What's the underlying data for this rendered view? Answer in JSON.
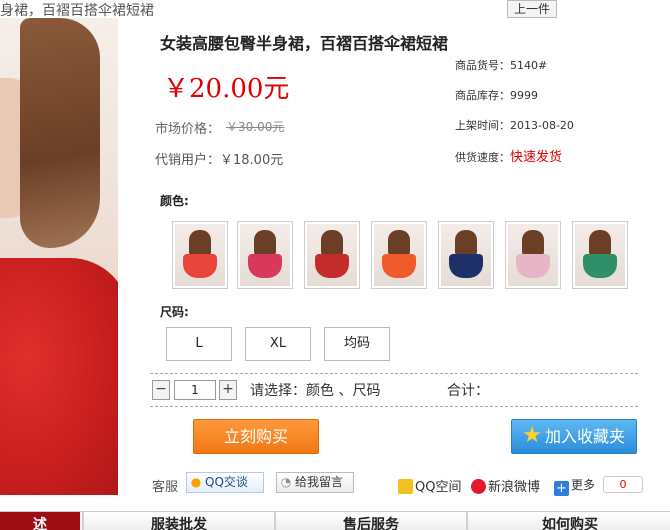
{
  "breadcrumb": "身裙，百褶百搭伞裙短裙",
  "prev_label": "上一件",
  "product": {
    "title": "女装高腰包臀半身裙，百褶百搭伞裙短裙",
    "price": "￥20.00元",
    "market_label": "市场价格：",
    "market_price": "￥30.00元",
    "agent_price": "代销用户：￥18.00元"
  },
  "info": {
    "sku": "商品货号：5140#",
    "stock": "商品库存：9999",
    "date": "上架时间：2013-08-20",
    "speed_label": "供货速度：",
    "speed_value": "快速发货"
  },
  "color_label": "颜色:",
  "colors": [
    "#e8453c",
    "#d8385a",
    "#c42b2b",
    "#ee5a2a",
    "#1f2f6a",
    "#e7b6c6",
    "#2f8f6a"
  ],
  "size_label": "尺码:",
  "sizes": [
    "L",
    "XL",
    "均码"
  ],
  "qty": {
    "minus": "−",
    "value": "1",
    "plus": "+"
  },
  "choose_text": "请选择：颜色  、尺码",
  "total_label": "合计：",
  "buy_label": "立刻购买",
  "fav_label": "加入收藏夹",
  "kefu_label": "客服",
  "qq_label": "QQ交谈",
  "msg_label": "给我留言",
  "share": {
    "qzone": "QQ空间",
    "weibo": "新浪微博",
    "more": "更多",
    "count": "0"
  },
  "tabs": [
    "述",
    "服装批发",
    "售后服务",
    "如何购买"
  ],
  "accent": "#e00000"
}
